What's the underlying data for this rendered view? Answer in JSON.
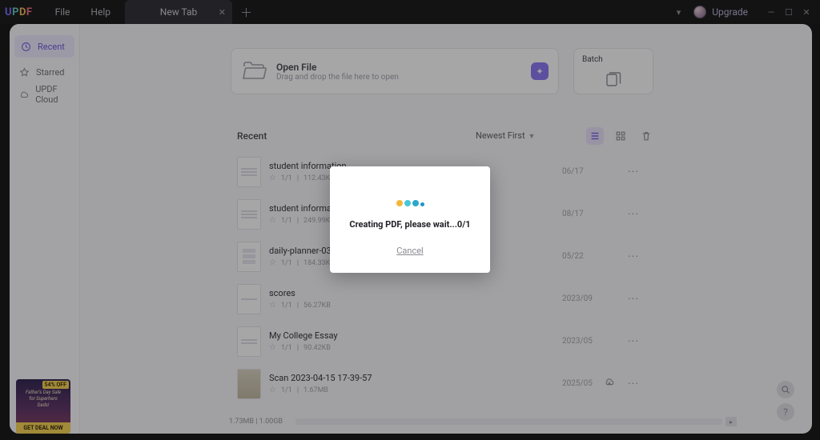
{
  "titlebar": {
    "menu_file": "File",
    "menu_help": "Help",
    "tab_label": "New Tab",
    "upgrade": "Upgrade"
  },
  "sidebar": {
    "items": [
      {
        "label": "Recent"
      },
      {
        "label": "Starred"
      },
      {
        "label": "UPDF Cloud"
      }
    ]
  },
  "open_file": {
    "title": "Open File",
    "subtitle": "Drag and drop the file here to open"
  },
  "batch": {
    "title": "Batch"
  },
  "recent_header": "Recent",
  "sort": {
    "label": "Newest First"
  },
  "files": [
    {
      "name": "student information",
      "pages": "1/1",
      "size": "112.43KB",
      "date": "06/17"
    },
    {
      "name": "student information",
      "pages": "1/1",
      "size": "249.99KB",
      "date": "08/17"
    },
    {
      "name": "daily-planner-03",
      "pages": "1/1",
      "size": "184.33KB",
      "date": "05/22"
    },
    {
      "name": "scores",
      "pages": "1/1",
      "size": "56.27KB",
      "date": "2023/09"
    },
    {
      "name": "My College Essay",
      "pages": "1/1",
      "size": "90.42KB",
      "date": "2023/05"
    },
    {
      "name": "Scan 2023-04-15 17-39-57",
      "pages": "1/1",
      "size": "1.67MB",
      "date": "2025/05",
      "cloud": true
    }
  ],
  "footer": {
    "storage": "1.73MB | 1.00GB"
  },
  "promo": {
    "badge": "54% OFF",
    "line1": "Father's Day Sale",
    "line2": "for Superhero",
    "line3": "Dads!",
    "cta": "GET DEAL NOW"
  },
  "modal": {
    "message": "Creating PDF, please wait...0/1",
    "cancel": "Cancel"
  }
}
